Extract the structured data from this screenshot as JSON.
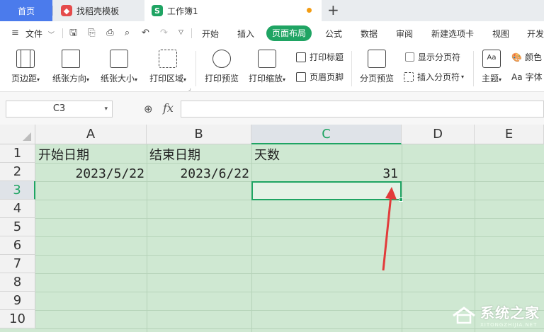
{
  "tabs": {
    "home": "首页",
    "template": "找稻壳模板",
    "document": "工作簿1",
    "doc_icon": "S",
    "add": "+"
  },
  "menu": {
    "file": "文件",
    "items": [
      "开始",
      "插入",
      "页面布局",
      "公式",
      "数据",
      "审阅",
      "新建选项卡",
      "视图",
      "开发"
    ],
    "active": "页面布局"
  },
  "ribbon": {
    "margins": "页边距",
    "orientation": "纸张方向",
    "size": "纸张大小",
    "print_area": "打印区域",
    "print_preview": "打印预览",
    "print_scale": "打印缩放",
    "print_titles": "打印标题",
    "header_footer": "页眉页脚",
    "page_break_preview": "分页预览",
    "show_page_breaks": "显示分页符",
    "insert_page_break": "插入分页符",
    "theme": "主题",
    "colors": "颜色",
    "fonts": "字体",
    "aa": "Aa"
  },
  "formula_bar": {
    "name_box": "C3",
    "fx": "fx",
    "formula": ""
  },
  "sheet": {
    "columns": [
      "A",
      "B",
      "C",
      "D",
      "E"
    ],
    "rows": [
      "1",
      "2",
      "3",
      "4",
      "5",
      "6",
      "7",
      "8",
      "9",
      "10"
    ],
    "selected_cell": "C3",
    "cells": {
      "A1": "开始日期",
      "B1": "结束日期",
      "C1": "天数",
      "A2": "2023/5/22",
      "B2": "2023/6/22",
      "C2": "31"
    }
  },
  "watermark": {
    "main": "系统之家",
    "sub": "XITONGZHIJIA.NET"
  },
  "colors": {
    "accent_green": "#1fa463",
    "sheet_bg": "#cfe8d2",
    "arrow_red": "#e23b3b",
    "home_tab": "#4b7bec"
  }
}
